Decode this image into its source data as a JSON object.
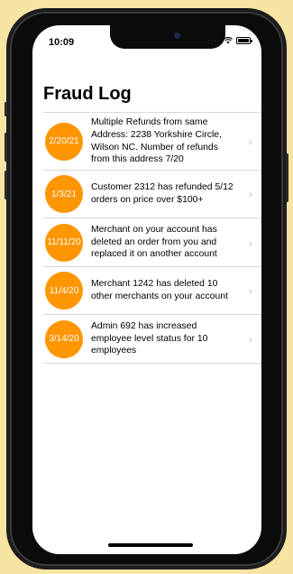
{
  "status_bar": {
    "time": "10:09"
  },
  "page": {
    "title": "Fraud Log"
  },
  "entries": [
    {
      "date": "2/20/21",
      "text": "Multiple Refunds from same Address: 2238 Yorkshire Circle, Wilson NC. Number of refunds from this address 7/20"
    },
    {
      "date": "1/3/21",
      "text": "Customer 2312 has refunded 5/12 orders on price over $100+"
    },
    {
      "date": "11/11/20",
      "text": "Merchant on your account has deleted an order from you and replaced it on another account"
    },
    {
      "date": "11/4/20",
      "text": "Merchant 1242 has deleted 10 other merchants on your account"
    },
    {
      "date": "3/14/20",
      "text": "Admin 692 has increased employee level status for 10 employees"
    }
  ],
  "colors": {
    "accent": "#ff9500",
    "background": "#f6e4a3"
  },
  "icons": {
    "row_disclosure": "chevron-right-icon"
  }
}
